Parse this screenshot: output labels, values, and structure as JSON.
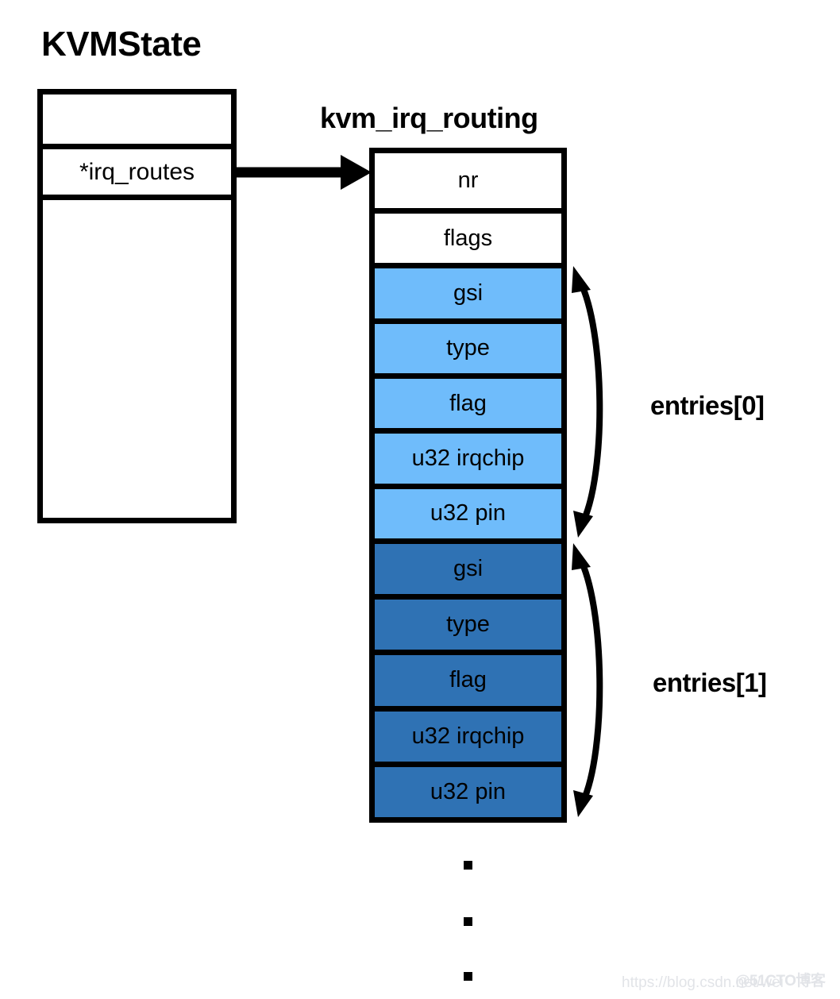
{
  "diagram": {
    "title_left": "KVMState",
    "title_right": "kvm_irq_routing",
    "pointer_arrow_name": "irq-routes-pointer-arrow"
  },
  "kvmstate": {
    "rows": [
      {
        "label": "",
        "fill": "white"
      },
      {
        "label": "*irq_routes",
        "fill": "white"
      },
      {
        "label": "",
        "fill": "white"
      }
    ]
  },
  "kvm_irq_routing": {
    "rows": [
      {
        "label": "nr",
        "fill": "white"
      },
      {
        "label": "flags",
        "fill": "white"
      },
      {
        "label": "gsi",
        "fill": "light-blue"
      },
      {
        "label": "type",
        "fill": "light-blue"
      },
      {
        "label": "flag",
        "fill": "light-blue"
      },
      {
        "label": "u32 irqchip",
        "fill": "light-blue"
      },
      {
        "label": "u32 pin",
        "fill": "light-blue"
      },
      {
        "label": "gsi",
        "fill": "dark-blue"
      },
      {
        "label": "type",
        "fill": "dark-blue"
      },
      {
        "label": "flag",
        "fill": "dark-blue"
      },
      {
        "label": "u32 irqchip",
        "fill": "dark-blue"
      },
      {
        "label": "u32 pin",
        "fill": "dark-blue"
      }
    ]
  },
  "annotations": {
    "entries_0": "entries[0]",
    "entries_1": "entries[1]",
    "ellipsis": [
      "▪",
      "▪",
      "▪"
    ]
  },
  "colors": {
    "light_blue": "#6FBCFB",
    "dark_blue": "#2F72B4",
    "stroke": "#000000",
    "background": "#FFFFFF",
    "watermark": "#E2E4E8"
  },
  "watermark": {
    "url": "https://blog.csdn.net/wei",
    "site": "@51CTO博客"
  }
}
